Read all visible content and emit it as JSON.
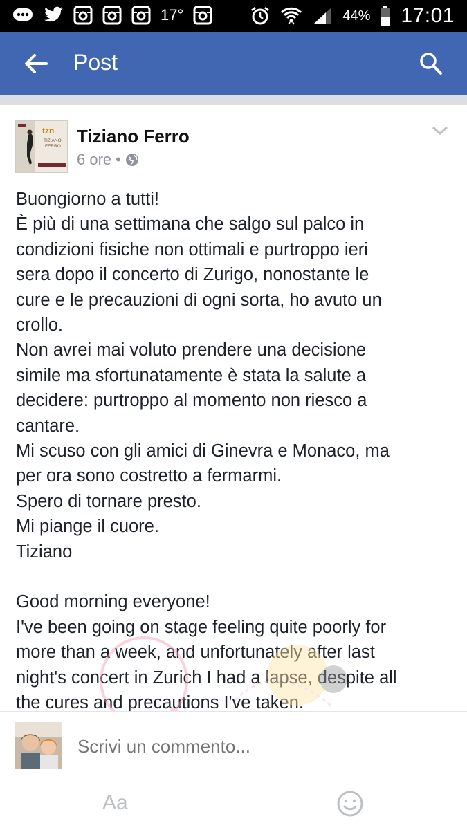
{
  "status_bar": {
    "temperature": "17°",
    "battery_percent": "44%",
    "time": "17:01",
    "left_icons": [
      "chat-bubble-icon",
      "twitter-icon",
      "instagram-icon",
      "instagram-icon",
      "instagram-icon",
      "instagram-icon"
    ],
    "right_icons": [
      "alarm-icon",
      "wifi-icon",
      "signal-icon",
      "battery-icon"
    ]
  },
  "app_bar": {
    "title": "Post",
    "back_icon": "arrow-left-icon",
    "search_icon": "search-icon",
    "color": "#4267b2"
  },
  "post": {
    "author": "Tiziano Ferro",
    "time_ago": "6 ore",
    "separator": "•",
    "privacy_icon": "globe-icon",
    "menu_icon": "chevron-down-icon",
    "lines": [
      "Buongiorno a tutti!",
      "È più di una settimana che salgo sul palco in",
      "condizioni fisiche non ottimali e purtroppo ieri",
      "sera dopo il concerto di Zurigo, nonostante le",
      "cure e le precauzioni di ogni sorta, ho avuto un",
      "crollo.",
      "Non avrei mai voluto prendere una decisione",
      "simile ma sfortunatamente è stata la salute a",
      "decidere: purtroppo al momento non riesco a",
      "cantare.",
      "Mi scuso con gli amici di Ginevra e Monaco, ma",
      "per ora sono costretto a fermarmi.",
      "Spero di tornare presto.",
      "Mi piange il cuore.",
      "Tiziano",
      "",
      "Good morning everyone!",
      "I've been going on stage feeling quite poorly for",
      "more than a week, and unfortunately after last",
      "night's concert in Zurich I had a lapse, despite all",
      "the cures and precautions I've taken."
    ]
  },
  "comment_bar": {
    "placeholder": "Scrivi un commento..."
  },
  "bottom_bar": {
    "aa_label": "Aa",
    "emoji_icon": "smiley-icon"
  }
}
